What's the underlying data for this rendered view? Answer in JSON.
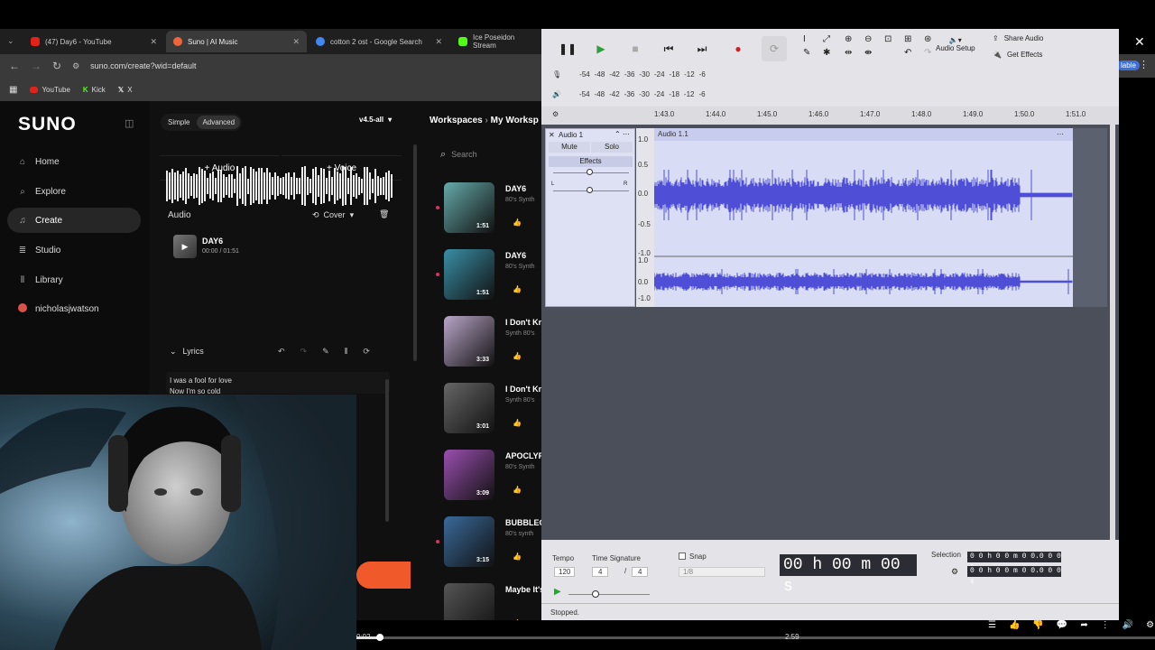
{
  "browser": {
    "tabs": [
      {
        "label": "(47) Day6 - YouTube",
        "color": "#e62117"
      },
      {
        "label": "Suno | AI Music",
        "color": "#f0643a"
      },
      {
        "label": "cotton 2 ost - Google Search",
        "color": "#4285f4"
      },
      {
        "label": "Ice Poseidon Stream",
        "color": "#53fc18"
      }
    ],
    "url": "suno.com/create?wid=default",
    "bookmarks": [
      "YouTube",
      "Kick",
      "X"
    ],
    "partial_right": "lable"
  },
  "suno": {
    "logo": "SUNO",
    "nav": [
      "Home",
      "Explore",
      "Create",
      "Studio",
      "Library",
      "nicholasjwatson"
    ],
    "mode_simple": "Simple",
    "mode_advanced": "Advanced",
    "model": "v4.5-all",
    "add_audio": "+  Audio",
    "add_voice": "+  Voice",
    "audio_label": "Audio",
    "cover_label": "Cover",
    "track_title": "DAY6",
    "track_time": "00:00 / 01:51",
    "lyrics_label": "Lyrics",
    "lyrics_lines": [
      "I was a fool for love",
      "Now I'm so cold"
    ],
    "workspaces": "Workspaces",
    "my_workspace": "My Worksp",
    "search_placeholder": "Search",
    "songs": [
      {
        "title": "DAY6",
        "sub": "80's Synth",
        "dur": "1:51",
        "color": "#6aa"
      },
      {
        "title": "DAY6",
        "sub": "80's Synth",
        "dur": "1:51",
        "color": "#3a8fa6"
      },
      {
        "title": "I Don't Kn",
        "sub": "Synth 80's",
        "dur": "3:33",
        "color": "#b9a6c9"
      },
      {
        "title": "I Don't Kn",
        "sub": "Synth 80's",
        "dur": "3:01",
        "color": "#666"
      },
      {
        "title": "APOCLYP",
        "sub": "80's Synth",
        "dur": "3:09",
        "color": "#9a4fb0"
      },
      {
        "title": "BUBBLEG",
        "sub": "80's synth",
        "dur": "3:15",
        "color": "#3a6a9a"
      },
      {
        "title": "Maybe It's",
        "sub": "",
        "dur": "",
        "color": "#555"
      }
    ]
  },
  "audacity": {
    "audio_setup": "Audio Setup",
    "share_audio": "Share Audio",
    "get_effects": "Get Effects",
    "meter_ticks": [
      "-54",
      "-48",
      "-42",
      "-36",
      "-30",
      "-24",
      "-18",
      "-12",
      "-6"
    ],
    "ruler": [
      "1:43.0",
      "1:44.0",
      "1:45.0",
      "1:46.0",
      "1:47.0",
      "1:48.0",
      "1:49.0",
      "1:50.0",
      "1:51.0"
    ],
    "track_name": "Audio 1",
    "clip_name": "Audio 1.1",
    "mute": "Mute",
    "solo": "Solo",
    "effects": "Effects",
    "lr_left": "L",
    "lr_right": "R",
    "scale_top": [
      "1.0",
      "0.5",
      "0.0",
      "-0.5",
      "-1.0"
    ],
    "scale_bottom": [
      "1.0",
      "0.0",
      "-1.0"
    ],
    "tempo_label": "Tempo",
    "tempo": "120",
    "timesig_label": "Time Signature",
    "timesig_num": "4",
    "timesig_den": "4",
    "snap_label": "Snap",
    "snap_value": "1/8",
    "time_display": "00 h 00 m 00 s",
    "selection_label": "Selection",
    "sel_start": "0 0 h 0 0 m 0 0.0 0 0 s",
    "sel_end": "0 0 h 0 0 m 0 0.0 0 0 s",
    "status": "Stopped."
  },
  "youtube": {
    "current": "0:02",
    "total": "2:59"
  }
}
